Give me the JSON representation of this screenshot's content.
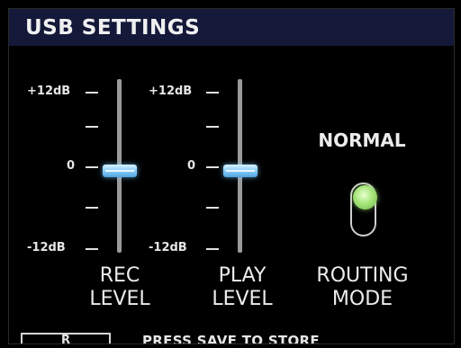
{
  "header": {
    "title": "USB SETTINGS"
  },
  "rec_level": {
    "scale": {
      "top": "+12dB",
      "middle": "0",
      "bottom": "-12dB"
    },
    "caption_line1": "REC",
    "caption_line2": "LEVEL",
    "value_db": 0
  },
  "play_level": {
    "scale": {
      "top": "+12dB",
      "middle": "0",
      "bottom": "-12dB"
    },
    "caption_line1": "PLAY",
    "caption_line2": "LEVEL",
    "value_db": 0
  },
  "routing_mode": {
    "value": "NORMAL",
    "caption_line1": "ROUTING",
    "caption_line2": "MODE",
    "toggle_color": "#a6e57a"
  },
  "footer": {
    "badge": "R",
    "status": "PRESS SAVE TO STORE"
  },
  "colors": {
    "header_bg": "#14193a",
    "fader_handle": "#8fd0ff",
    "background": "#000000"
  }
}
